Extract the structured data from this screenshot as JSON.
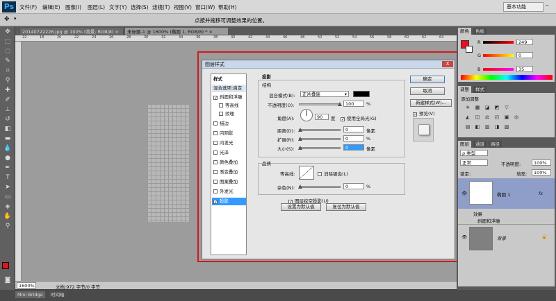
{
  "app": {
    "logo": "Ps"
  },
  "menu": [
    "文件(F)",
    "编辑(E)",
    "图像(I)",
    "图层(L)",
    "文字(Y)",
    "选择(S)",
    "滤镜(T)",
    "视图(V)",
    "窗口(W)",
    "帮助(H)"
  ],
  "workspace": "基本功能",
  "options_message": "点按并拖移可调整效果的位置。",
  "doc_tabs": [
    "20140722226.jpg @ 100% (背景, RGB/8) ×",
    "未标题-1 @ 1600% (椭圆 1, RGB/8) * ×"
  ],
  "ruler_numbers": [
    "22",
    "18",
    "20",
    "22",
    "24",
    "26",
    "28",
    "30",
    "32",
    "34",
    "36",
    "38",
    "40",
    "42",
    "44",
    "46",
    "48",
    "50",
    "52",
    "54",
    "56",
    "58",
    "60",
    "62",
    "64"
  ],
  "dialog": {
    "title": "图层样式",
    "styles_header": "样式",
    "blend_options": "混合选项:自定",
    "style_items": [
      {
        "label": "斜面和浮雕",
        "checked": true
      },
      {
        "label": "等高线",
        "checked": false
      },
      {
        "label": "纹理",
        "checked": false
      },
      {
        "label": "描边",
        "checked": false
      },
      {
        "label": "内阴影",
        "checked": false
      },
      {
        "label": "内发光",
        "checked": false
      },
      {
        "label": "光泽",
        "checked": false
      },
      {
        "label": "颜色叠加",
        "checked": false
      },
      {
        "label": "渐变叠加",
        "checked": false
      },
      {
        "label": "图案叠加",
        "checked": false
      },
      {
        "label": "外发光",
        "checked": false
      },
      {
        "label": "投影",
        "checked": true
      }
    ],
    "section_title": "投影",
    "structure_title": "结构",
    "blend_mode_label": "混合模式(B):",
    "blend_mode_value": "正片叠底",
    "opacity_label": "不透明度(O):",
    "opacity_value": "100",
    "percent": "%",
    "angle_label": "角度(A):",
    "angle_value": "90",
    "degree_unit": "度",
    "global_light_label": "使用全局光(G)",
    "distance_label": "距离(D):",
    "distance_value": "0",
    "spread_label": "扩展(R):",
    "spread_value": "0",
    "size_label": "大小(S):",
    "size_value": "0",
    "pixel_unit": "像素",
    "quality_title": "品质",
    "contour_label": "等高线:",
    "antialias_label": "消除锯齿(L)",
    "noise_label": "杂色(N):",
    "noise_value": "0",
    "knockout_label": "图层挖空投影(U)",
    "set_default": "设置为默认值",
    "reset_default": "复位为默认值",
    "ok": "确定",
    "cancel": "取消",
    "new_style": "新建样式(W)...",
    "preview_label": "预览(V)",
    "close": "X"
  },
  "color_panel": {
    "tabs": [
      "颜色",
      "色板"
    ],
    "r_value": "249",
    "g_value": "0",
    "b_value": "35",
    "foreground": "#e8101e"
  },
  "adjust_panel": {
    "tabs": [
      "调整",
      "样式"
    ],
    "add_label": "添加调整",
    "icons": [
      "☀",
      "▦",
      "◪",
      "◩",
      "▽",
      "◭",
      "◫",
      "⚖",
      "◰",
      "▣",
      "◎",
      "▤",
      "◧",
      "▥",
      "◨",
      "▧"
    ]
  },
  "layers_panel": {
    "tabs": [
      "图层",
      "通道",
      "路径"
    ],
    "filter_label": "ρ 类型",
    "blend_mode": "正常",
    "opacity_label": "不透明度:",
    "opacity_value": "100%",
    "lock_label": "锁定:",
    "fill_label": "填充:",
    "fill_value": "100%",
    "layers": [
      {
        "name": "椭圆 1",
        "fx": "fx"
      },
      {
        "name": "效果"
      },
      {
        "name": "斜面和浮雕"
      },
      {
        "name": "背景"
      }
    ]
  },
  "status": {
    "zoom": "1600%",
    "doc": "文档:972 字节/0 字节"
  },
  "bottom": {
    "tabs": [
      "Mini Bridge",
      "时间轴"
    ]
  }
}
